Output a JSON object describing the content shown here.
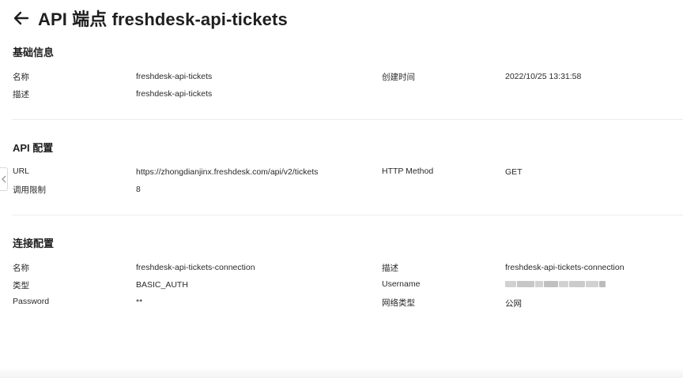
{
  "header": {
    "title": "API 端点 freshdesk-api-tickets"
  },
  "basic_info": {
    "section_title": "基础信息",
    "name_label": "名称",
    "name_value": "freshdesk-api-tickets",
    "created_label": "创建时间",
    "created_value": "2022/10/25 13:31:58",
    "desc_label": "描述",
    "desc_value": "freshdesk-api-tickets"
  },
  "api_config": {
    "section_title": "API 配置",
    "url_label": "URL",
    "url_value": "https://zhongdianjinx.freshdesk.com/api/v2/tickets",
    "method_label": "HTTP Method",
    "method_value": "GET",
    "limit_label": "调用限制",
    "limit_value": "8"
  },
  "connection_config": {
    "section_title": "连接配置",
    "name_label": "名称",
    "name_value": "freshdesk-api-tickets-connection",
    "desc_label": "描述",
    "desc_value": "freshdesk-api-tickets-connection",
    "type_label": "类型",
    "type_value": "BASIC_AUTH",
    "username_label": "Username",
    "password_label": "Password",
    "password_value": "**",
    "network_label": "网络类型",
    "network_value": "公网"
  },
  "icons": {
    "back": "arrow-left-icon",
    "collapse": "chevron-left-icon"
  }
}
